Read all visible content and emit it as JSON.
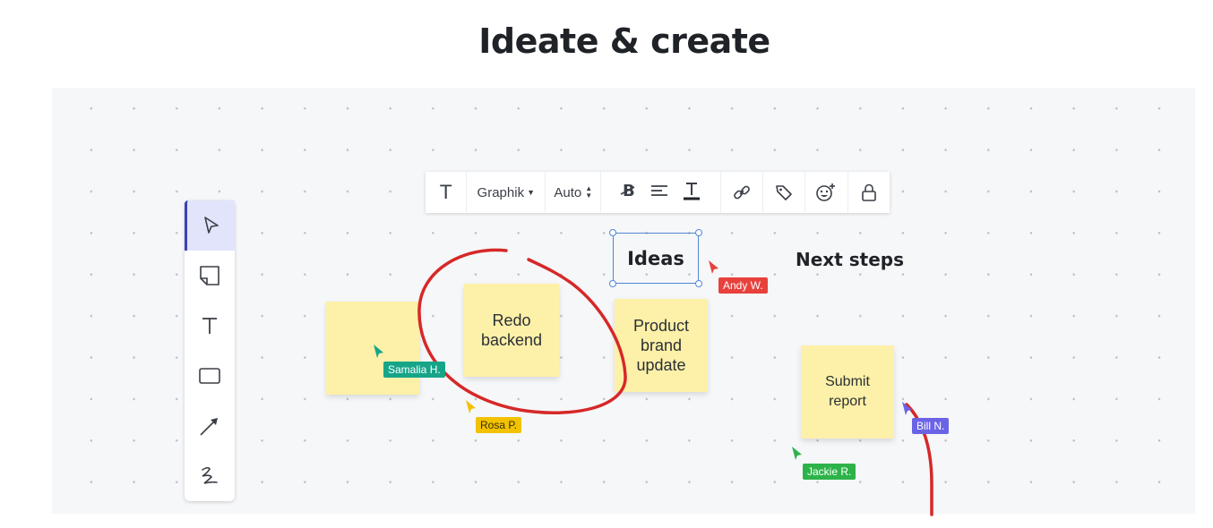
{
  "heading": "Ideate & create",
  "format_toolbar": {
    "text_glyph": "T",
    "font": "Graphik",
    "size": "Auto"
  },
  "labels": {
    "ideas": "Ideas",
    "next_steps": "Next steps"
  },
  "stickies": [
    {
      "text": ""
    },
    {
      "text": "Redo\nbackend"
    },
    {
      "text": "Product\nbrand\nupdate"
    },
    {
      "text": "Submit\nreport"
    }
  ],
  "collaborators": [
    {
      "name": "Andy W.",
      "color": "#e8413c"
    },
    {
      "name": "Samalia H.",
      "color": "#17a589"
    },
    {
      "name": "Rosa P.",
      "color": "#f2c200"
    },
    {
      "name": "Jackie R.",
      "color": "#2db34a"
    },
    {
      "name": "Bill N.",
      "color": "#6b63e6"
    }
  ],
  "colors": {
    "sticky": "#fdf0a8",
    "selection": "#4f86d6",
    "drawing": "#d62828",
    "active_tool": "#3b3fb8"
  },
  "tool_icons": [
    "select-arrow-icon",
    "sticky-note-icon",
    "text-tool-icon",
    "rectangle-icon",
    "line-arrow-icon",
    "freehand-draw-icon"
  ]
}
